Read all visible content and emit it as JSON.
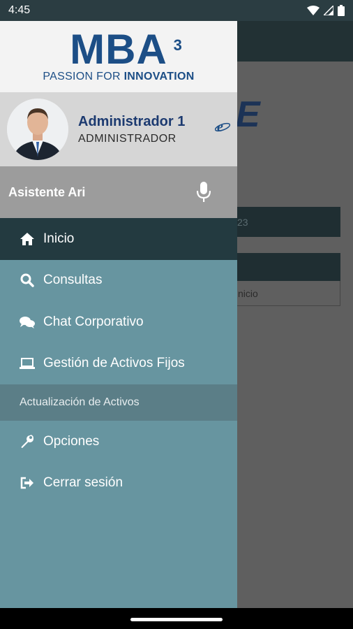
{
  "status_bar": {
    "time": "4:45"
  },
  "background": {
    "logo_partial": "E",
    "date_partial": "23",
    "card_text_partial": "nicio"
  },
  "drawer": {
    "logo": {
      "brand": "MBA",
      "superscript": "3",
      "tagline_prefix": "PASSION FOR ",
      "tagline_bold": "INNOVATION"
    },
    "profile": {
      "name": "Administrador 1",
      "role": "ADMINISTRADOR"
    },
    "assistant": {
      "label": "Asistente Ari"
    },
    "menu": [
      {
        "label": "Inicio",
        "icon": "home-icon",
        "active": true
      },
      {
        "label": "Consultas",
        "icon": "search-icon"
      },
      {
        "label": "Chat Corporativo",
        "icon": "chat-icon"
      },
      {
        "label": "Gestión de Activos Fijos",
        "icon": "laptop-icon"
      }
    ],
    "section_header": "Actualización de Activos",
    "menu2": [
      {
        "label": "Opciones",
        "icon": "wrench-icon"
      },
      {
        "label": "Cerrar sesión",
        "icon": "logout-icon"
      }
    ]
  },
  "colors": {
    "drawer_bg": "#6795a0",
    "active_item": "#233a40",
    "brand_blue": "#1c4e86"
  }
}
